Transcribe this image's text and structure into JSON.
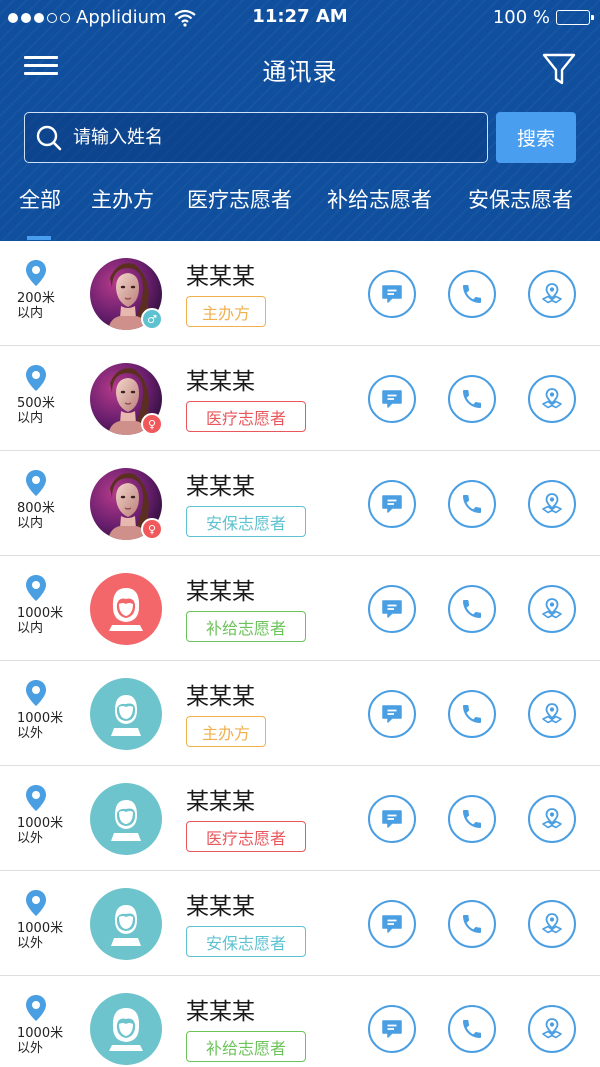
{
  "status_bar": {
    "carrier": "Applidium",
    "time": "11:27 AM",
    "battery": "100 %",
    "signal_bars": 3
  },
  "navbar": {
    "title": "通讯录",
    "menu_icon": "menu-icon",
    "filter_icon": "filter-icon"
  },
  "search": {
    "placeholder": "请输入姓名",
    "value": "",
    "button_label": "搜索"
  },
  "tabs": [
    {
      "label": "全部",
      "active": true
    },
    {
      "label": "主办方",
      "active": false
    },
    {
      "label": "医疗志愿者",
      "active": false
    },
    {
      "label": "补给志愿者",
      "active": false
    },
    {
      "label": "安保志愿者",
      "active": false
    }
  ],
  "colors": {
    "header_blue": "#0f4f9e",
    "accent_blue": "#4a9ef0",
    "icon_blue": "#4a9ee2",
    "tag_organizer": "#f1b04f",
    "tag_medical": "#e8575b",
    "tag_security": "#5ec2d0",
    "tag_supply": "#6cc35a",
    "avatar_teal": "#6ec4cc",
    "avatar_red": "#f3676b",
    "badge_teal": "#5ec2d0",
    "badge_red": "#f0585c"
  },
  "contacts": [
    {
      "distance": "200米",
      "range": "以内",
      "name": "某某某",
      "tag": "主办方",
      "tag_type": "organizer",
      "avatar": "photo",
      "badge": "male-icon",
      "badge_glyph": "♂"
    },
    {
      "distance": "500米",
      "range": "以内",
      "name": "某某某",
      "tag": "医疗志愿者",
      "tag_type": "medical",
      "avatar": "photo",
      "badge": "female-icon",
      "badge_glyph": "♀"
    },
    {
      "distance": "800米",
      "range": "以内",
      "name": "某某某",
      "tag": "安保志愿者",
      "tag_type": "security",
      "avatar": "photo",
      "badge": "female-icon",
      "badge_glyph": "♀"
    },
    {
      "distance": "1000米",
      "range": "以内",
      "name": "某某某",
      "tag": "补给志愿者",
      "tag_type": "supply",
      "avatar": "female-default",
      "badge": ""
    },
    {
      "distance": "1000米",
      "range": "以外",
      "name": "某某某",
      "tag": "主办方",
      "tag_type": "organizer",
      "avatar": "male-default",
      "badge": ""
    },
    {
      "distance": "1000米",
      "range": "以外",
      "name": "某某某",
      "tag": "医疗志愿者",
      "tag_type": "medical",
      "avatar": "male-default",
      "badge": ""
    },
    {
      "distance": "1000米",
      "range": "以外",
      "name": "某某某",
      "tag": "安保志愿者",
      "tag_type": "security",
      "avatar": "male-default",
      "badge": ""
    },
    {
      "distance": "1000米",
      "range": "以外",
      "name": "某某某",
      "tag": "补给志愿者",
      "tag_type": "supply",
      "avatar": "female-default",
      "badge": ""
    }
  ],
  "row_actions": {
    "message_icon": "message-icon",
    "call_icon": "phone-icon",
    "navigate_icon": "navigation-icon",
    "location_icon": "location-pin-icon"
  }
}
